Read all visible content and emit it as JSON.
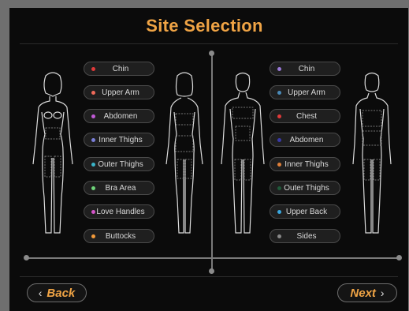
{
  "header": {
    "title": "Site Selection"
  },
  "female": {
    "sites": [
      {
        "label": "Chin",
        "color": "#e03a3a"
      },
      {
        "label": "Upper Arm",
        "color": "#f06a5a"
      },
      {
        "label": "Abdomen",
        "color": "#c15ad6"
      },
      {
        "label": "Inner Thighs",
        "color": "#7a7fd8"
      },
      {
        "label": "Outer Thighs",
        "color": "#3ab4c8"
      },
      {
        "label": "Bra Area",
        "color": "#6fd47a"
      },
      {
        "label": "Love Handles",
        "color": "#d455c8"
      },
      {
        "label": "Buttocks",
        "color": "#f29a3a"
      }
    ]
  },
  "male": {
    "sites": [
      {
        "label": "Chin",
        "color": "#9a7ad8"
      },
      {
        "label": "Upper Arm",
        "color": "#4a8ab8"
      },
      {
        "label": "Chest",
        "color": "#e03a3a"
      },
      {
        "label": "Abdomen",
        "color": "#3a3aa8"
      },
      {
        "label": "Inner Thighs",
        "color": "#e0803a"
      },
      {
        "label": "Outer Thighs",
        "color": "#1f5a3a"
      },
      {
        "label": "Upper Back",
        "color": "#3aa8e0"
      },
      {
        "label": "Sides",
        "color": "#8a8a8a"
      }
    ]
  },
  "nav": {
    "back_label": "Back",
    "next_label": "Next",
    "back_arrow": "‹",
    "next_arrow": "›"
  }
}
